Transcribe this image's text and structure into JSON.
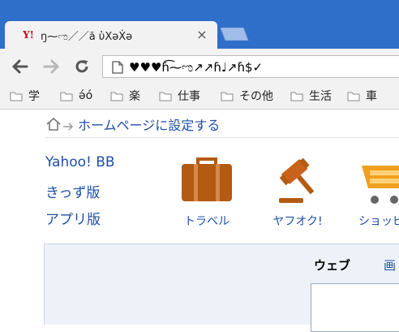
{
  "browser": {
    "tab": {
      "favicon_text": "Y!",
      "title": "ŋ⁓ಌ／／ă ὑXəẊə",
      "close_glyph": "×"
    },
    "omnibox": {
      "url": "♥♥♥ɦ͡⁓ಌ↗↗ɦ♩↗ɦ$✓"
    },
    "bookmarks": [
      {
        "label": "学"
      },
      {
        "label": "ə́ó"
      },
      {
        "label": "楽"
      },
      {
        "label": "仕事"
      },
      {
        "label": "その他"
      },
      {
        "label": "生活"
      },
      {
        "label": "車"
      }
    ],
    "colors": {
      "tabstrip": "#2f6fc9",
      "chrome": "#f2f2f2",
      "link": "#1e4fa8",
      "brand_orange": "#b35a13"
    }
  },
  "page": {
    "home_link": "ホームページに設定する",
    "side_links": [
      {
        "label": "Yahoo! BB"
      },
      {
        "label": "きっず版"
      },
      {
        "label": "アプリ版"
      }
    ],
    "services": [
      {
        "label": "トラベル",
        "icon": "suitcase-icon"
      },
      {
        "label": "ヤフオク!",
        "icon": "gavel-icon"
      },
      {
        "label": "ショッピ",
        "icon": "shopping-cart-icon"
      }
    ],
    "search": {
      "tabs": [
        {
          "label": "ウェブ",
          "active": true
        },
        {
          "label": "画",
          "active": false
        }
      ]
    }
  }
}
